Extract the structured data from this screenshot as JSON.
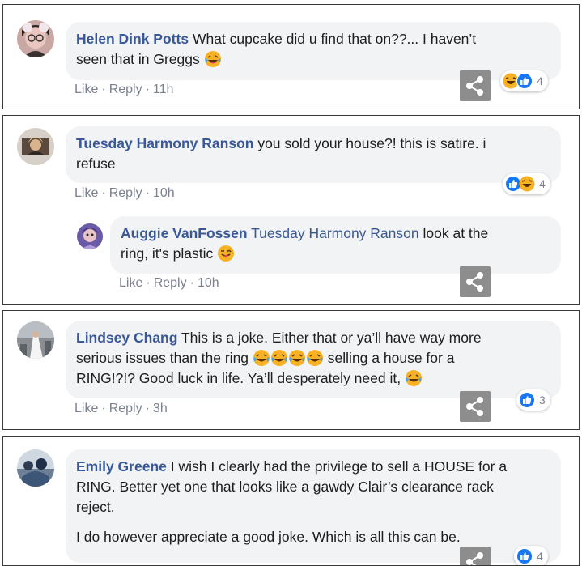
{
  "colors": {
    "author": "#385898",
    "bubble": "#f2f3f5",
    "meta": "#7b8190",
    "share_bg": "#8d8d8d",
    "like_blue": "#1877f2",
    "haha_yellow": "#f7b125"
  },
  "action_labels": {
    "like": "Like",
    "reply": "Reply"
  },
  "comments": [
    {
      "author": "Helen Dink Potts",
      "text_1": "What cupcake did u find that on??... I haven’t",
      "text_2": "seen that in Greggs",
      "emoji": "laughing-tears",
      "time": "11h",
      "reactions": [
        "haha",
        "like"
      ],
      "reaction_count": "4"
    },
    {
      "author": "Tuesday Harmony Ranson",
      "text_1": "you sold your house?! this is satire. i",
      "text_2": "refuse",
      "time": "10h",
      "reactions": [
        "like",
        "haha"
      ],
      "reaction_count": "4",
      "reply": {
        "author": "Auggie VanFossen",
        "mention": "Tuesday Harmony Ranson",
        "text_1": "look at the",
        "text_2": "ring, it's plastic",
        "emoji": "tongue-wink",
        "time": "10h"
      }
    },
    {
      "author": "Lindsey Chang",
      "text_1": "This is a joke. Either that or ya’ll have way more",
      "text_2a": "serious issues than the ring",
      "emoji_run": [
        "laughing-tears",
        "laughing-tears",
        "laughing-tears",
        "laughing-tears"
      ],
      "text_2b": "selling a house for a",
      "text_3": "RING!?!? Good luck in life. Ya’ll desperately need it,",
      "emoji": "laughing-tears",
      "time": "3h",
      "reactions": [
        "like"
      ],
      "reaction_count": "3"
    },
    {
      "author": "Emily Greene",
      "text_1": "I wish I clearly had the privilege to sell a HOUSE for a",
      "text_2": "RING. Better yet one that looks like a gawdy Clair’s clearance rack",
      "text_3": "reject.",
      "text_4": "I do however appreciate a good joke. Which is all this can be.",
      "reactions": [
        "like"
      ],
      "reaction_count": "4"
    }
  ]
}
